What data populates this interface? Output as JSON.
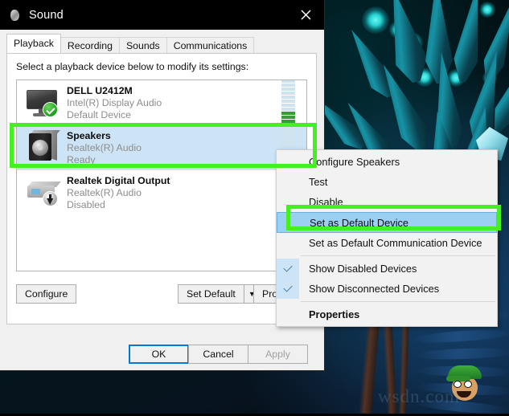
{
  "window": {
    "title": "Sound",
    "icon": "sound-speaker-icon",
    "close_label": "×"
  },
  "tabs": [
    {
      "label": "Playback",
      "active": true
    },
    {
      "label": "Recording",
      "active": false
    },
    {
      "label": "Sounds",
      "active": false
    },
    {
      "label": "Communications",
      "active": false
    }
  ],
  "playback": {
    "hint": "Select a playback device below to modify its settings:",
    "devices": [
      {
        "name": "DELL U2412M",
        "driver": "Intel(R) Display Audio",
        "status": "Default Device",
        "icon": "monitor-icon",
        "badge": "green-check-badge",
        "selected": false,
        "meter_total": 12,
        "meter_active": 4
      },
      {
        "name": "Speakers",
        "driver": "Realtek(R) Audio",
        "status": "Ready",
        "icon": "speaker-icon",
        "badge": "none",
        "selected": true,
        "meter_total": 12,
        "meter_active": 0
      },
      {
        "name": "Realtek Digital Output",
        "driver": "Realtek(R) Audio",
        "status": "Disabled",
        "icon": "digital-output-icon",
        "badge": "gray-down-arrow-badge",
        "selected": false,
        "meter_total": 0,
        "meter_active": 0
      }
    ],
    "buttons": {
      "configure": "Configure",
      "set_default": "Set Default",
      "set_default_arrow": "▼",
      "properties": "Properties"
    }
  },
  "footer": {
    "ok": "OK",
    "cancel": "Cancel",
    "apply": "Apply"
  },
  "context_menu": {
    "items": [
      {
        "label": "Configure Speakers",
        "type": "item",
        "checked": false,
        "highlighted": false,
        "bold": false
      },
      {
        "label": "Test",
        "type": "item",
        "checked": false,
        "highlighted": false,
        "bold": false
      },
      {
        "label": "Disable",
        "type": "item",
        "checked": false,
        "highlighted": false,
        "bold": false
      },
      {
        "label": "Set as Default Device",
        "type": "item",
        "checked": false,
        "highlighted": true,
        "bold": false
      },
      {
        "label": "Set as Default Communication Device",
        "type": "item",
        "checked": false,
        "highlighted": false,
        "bold": false
      },
      {
        "label": "Show Disabled Devices",
        "type": "check",
        "checked": true,
        "highlighted": false,
        "bold": false
      },
      {
        "label": "Show Disconnected Devices",
        "type": "check",
        "checked": true,
        "highlighted": false,
        "bold": false
      },
      {
        "label": "Properties",
        "type": "item",
        "checked": false,
        "highlighted": false,
        "bold": true
      }
    ]
  },
  "annotations": {
    "color": "#44ef22",
    "boxes": [
      "speakers-device-row",
      "set-as-default-device-menu-item"
    ]
  },
  "desktop": {
    "watermark": "wsdn.com"
  }
}
